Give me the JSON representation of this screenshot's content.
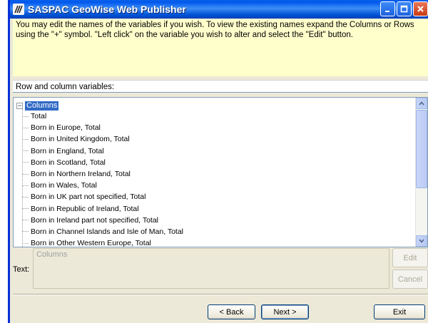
{
  "window": {
    "title": "SASPAC GeoWise Web Publisher"
  },
  "info": {
    "text": "You may edit the names of the variables if you wish.  To view the existing names expand the Columns or Rows using the \"+\" symbol.  \"Left click\" on the variable you wish to alter and select the \"Edit\" button."
  },
  "section": {
    "label": "Row and column variables:"
  },
  "tree": {
    "root": {
      "label": "Columns",
      "expander": "−"
    },
    "items": [
      "Total",
      "Born in Europe, Total",
      "Born in United Kingdom, Total",
      "Born in England, Total",
      "Born in Scotland, Total",
      "Born in Northern Ireland, Total",
      "Born in Wales, Total",
      "Born in UK part not specified, Total",
      "Born in Republic of Ireland, Total",
      "Born in Ireland part not specified, Total",
      "Born in Channel Islands and Isle of Man, Total",
      "Born in Other Western Europe, Total"
    ]
  },
  "text_field": {
    "label": "Text:",
    "value": "Columns"
  },
  "side_buttons": {
    "edit": "Edit",
    "cancel": "Cancel"
  },
  "nav_buttons": {
    "back": "< Back",
    "next": "Next >",
    "exit": "Exit"
  },
  "colors": {
    "titlebar": "#0058ee",
    "info_background": "#ffffcc",
    "selection": "#316ac5",
    "dialog_background": "#ece9d8"
  }
}
